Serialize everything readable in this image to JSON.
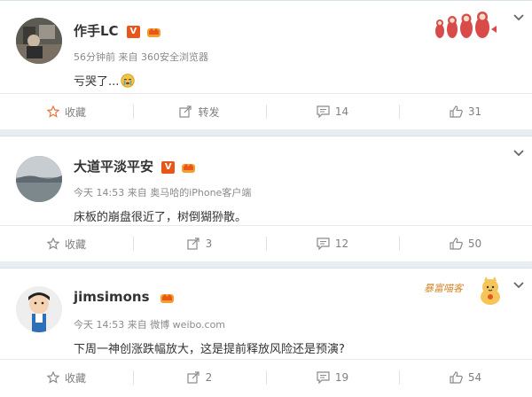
{
  "posts": [
    {
      "author": "作手LC",
      "meta": "56分钟前 来自 360安全浏览器",
      "text": "亏哭了...",
      "emoji": "cry-emoji",
      "actions": {
        "first_label": "收藏",
        "repost_label": "转发",
        "comment_count": "14",
        "like_count": "31"
      },
      "first_action_is_favorite": true,
      "first_action_color": "#e8743b"
    },
    {
      "author": "大道平淡平安",
      "meta": "今天 14:53 来自 奥马哈的iPhone客户端",
      "text": "床板的崩盘很近了，树倒猢狲散。",
      "actions": {
        "first_label": "收藏",
        "repost_label": "3",
        "comment_count": "12",
        "like_count": "50"
      }
    },
    {
      "author": "jimsimons",
      "meta": "今天 14:53 来自 微博 weibo.com",
      "text": "下周一神创涨跌幅放大，这是提前释放风险还是预演?",
      "actions": {
        "first_label": "收藏",
        "repost_label": "2",
        "comment_count": "19",
        "like_count": "54"
      },
      "decoration_text": "暴富喵客"
    }
  ],
  "colors": {
    "page_bg": "#e6eef3",
    "v_badge": "#e8561b",
    "icon_gray": "#8a8a8a"
  }
}
